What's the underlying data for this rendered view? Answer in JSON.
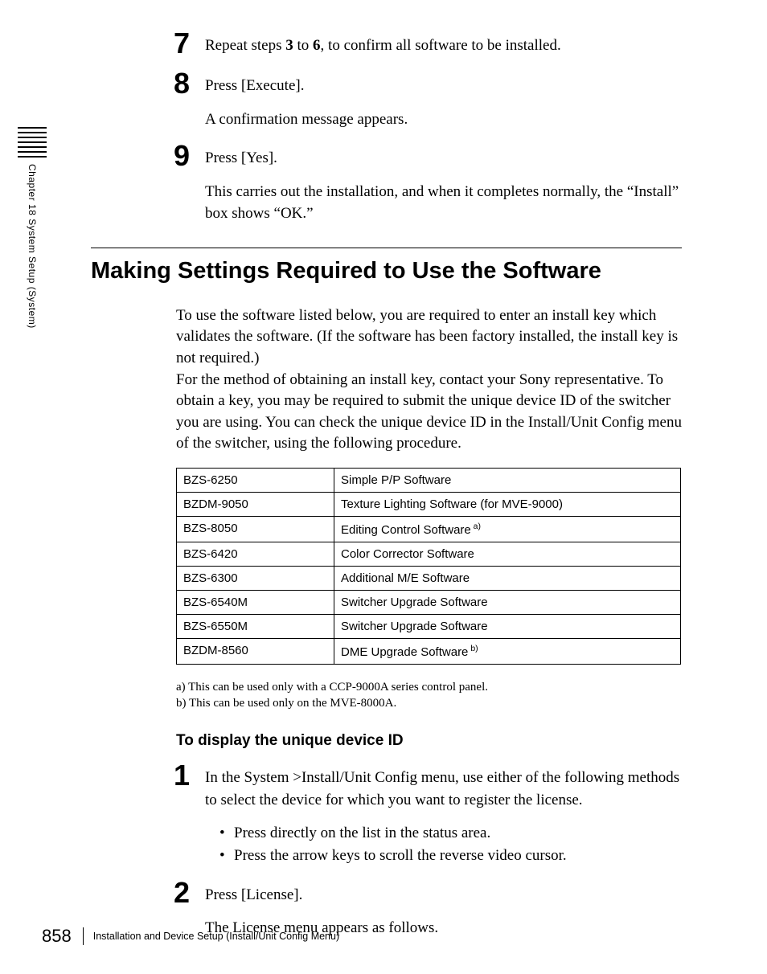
{
  "side": {
    "label": "Chapter 18  System Setup (System)"
  },
  "steps_top": [
    {
      "num": "7",
      "line": {
        "pre": "Repeat steps ",
        "b1": "3",
        "mid": " to ",
        "b2": "6",
        "post": ", to confirm all software to be installed."
      }
    },
    {
      "num": "8",
      "text": "Press [Execute].",
      "sub": "A confirmation message appears."
    },
    {
      "num": "9",
      "text": "Press [Yes].",
      "sub": "This carries out the installation, and when it completes normally, the “Install” box shows “OK.”"
    }
  ],
  "section_title": "Making Settings Required to Use the Software",
  "intro": {
    "p1": "To use the software listed below, you are required to enter an install key which validates the software. (If the software has been factory installed, the install key is not required.)",
    "p2": "For the method of obtaining an install key, contact your Sony representative. To obtain a key, you may be required to submit the unique device ID of the switcher you are using. You can check the unique device ID in the Install/Unit Config menu of the switcher, using the following procedure."
  },
  "table": [
    {
      "model": "BZS-6250",
      "desc": "Simple P/P Software",
      "sup": ""
    },
    {
      "model": "BZDM-9050",
      "desc": "Texture Lighting Software (for MVE-9000)",
      "sup": ""
    },
    {
      "model": "BZS-8050",
      "desc": "Editing Control Software",
      "sup": " a)"
    },
    {
      "model": "BZS-6420",
      "desc": "Color Corrector Software",
      "sup": ""
    },
    {
      "model": "BZS-6300",
      "desc": "Additional M/E Software",
      "sup": ""
    },
    {
      "model": "BZS-6540M",
      "desc": "Switcher Upgrade Software",
      "sup": ""
    },
    {
      "model": "BZS-6550M",
      "desc": "Switcher Upgrade Software",
      "sup": ""
    },
    {
      "model": "BZDM-8560",
      "desc": "DME Upgrade Software",
      "sup": " b)"
    }
  ],
  "footnotes": {
    "a": "a) This can be used only with a CCP-9000A series control panel.",
    "b": "b) This can be used only on the MVE-8000A."
  },
  "sub_heading": "To display the unique device ID",
  "steps_bottom": [
    {
      "num": "1",
      "text": "In the System >Install/Unit Config menu, use either of the following methods to select the device for which you want to register the license.",
      "bullets": [
        "Press directly on the list in the status area.",
        "Press the arrow keys to scroll the reverse video cursor."
      ]
    },
    {
      "num": "2",
      "text": "Press [License].",
      "sub": "The License menu appears as follows."
    }
  ],
  "footer": {
    "page": "858",
    "text": "Installation and Device Setup (Install/Unit Config Menu)"
  }
}
